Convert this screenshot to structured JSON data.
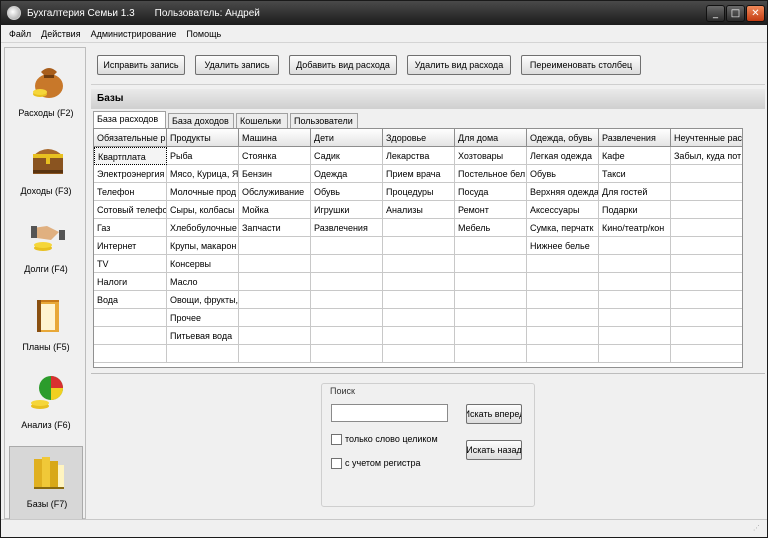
{
  "window": {
    "title": "Бухгалтерия Семьи 1.3",
    "user": "Пользователь: Андрей",
    "min_glyph": "_",
    "max_glyph": "□",
    "close_glyph": "✕"
  },
  "menu": [
    "Файл",
    "Действия",
    "Администрирование",
    "Помощь"
  ],
  "sidebar": [
    {
      "label": "Расходы (F2)",
      "icon": "money-bag-icon"
    },
    {
      "label": "Доходы (F3)",
      "icon": "treasure-chest-icon"
    },
    {
      "label": "Долги (F4)",
      "icon": "handshake-coins-icon"
    },
    {
      "label": "Планы (F5)",
      "icon": "folder-icon"
    },
    {
      "label": "Анализ (F6)",
      "icon": "pie-chart-coins-icon"
    },
    {
      "label": "Базы (F7)",
      "icon": "books-icon"
    }
  ],
  "toolbar": {
    "edit": "Исправить запись",
    "delete": "Удалить запись",
    "add_type": "Добавить вид расхода",
    "delete_type": "Удалить вид расхода",
    "rename_col": "Переименовать столбец"
  },
  "section_title": "Базы",
  "tabs": [
    "База расходов",
    "База доходов",
    "Кошельки",
    "Пользователи"
  ],
  "grid": {
    "columns": [
      "Обязательные р",
      "Продукты",
      "Машина",
      "Дети",
      "Здоровье",
      "Для дома",
      "Одежда, обувь",
      "Развлечения",
      "Неучтенные рас"
    ],
    "rows": [
      [
        "Квартплата",
        "Рыба",
        "Стоянка",
        "Садик",
        "Лекарства",
        "Хозтовары",
        "Легкая одежда",
        "Кафе",
        "Забыл, куда пот"
      ],
      [
        "Электроэнергия",
        "Мясо, Курица, Я",
        "Бензин",
        "Одежда",
        "Прием врача",
        "Постельное бел",
        "Обувь",
        "Такси",
        ""
      ],
      [
        "Телефон",
        "Молочные прод",
        "Обслуживание",
        "Обувь",
        "Процедуры",
        "Посуда",
        "Верхняя одежда",
        "Для гостей",
        ""
      ],
      [
        "Сотовый телефо",
        "Сыры, колбасы",
        "Мойка",
        "Игрушки",
        "Анализы",
        "Ремонт",
        "Аксессуары",
        "Подарки",
        ""
      ],
      [
        "Газ",
        "Хлебобулочные",
        "Запчасти",
        "Развлечения",
        "",
        "Мебель",
        "Сумка, перчатк",
        "Кино/театр/кон",
        ""
      ],
      [
        "Интернет",
        "Крупы, макарон",
        "",
        "",
        "",
        "",
        "Нижнее белье",
        "",
        ""
      ],
      [
        "TV",
        "Консервы",
        "",
        "",
        "",
        "",
        "",
        "",
        ""
      ],
      [
        "Налоги",
        "Масло",
        "",
        "",
        "",
        "",
        "",
        "",
        ""
      ],
      [
        "Вода",
        "Овощи, фрукты,",
        "",
        "",
        "",
        "",
        "",
        "",
        ""
      ],
      [
        "",
        "Прочее",
        "",
        "",
        "",
        "",
        "",
        "",
        ""
      ],
      [
        "",
        "Питьевая вода",
        "",
        "",
        "",
        "",
        "",
        "",
        ""
      ],
      [
        "",
        "",
        "",
        "",
        "",
        "",
        "",
        "",
        ""
      ]
    ]
  },
  "search": {
    "title": "Поиск",
    "value": "",
    "forward": "Искать вперед",
    "backward": "Искать назад",
    "whole_word": "только слово целиком",
    "match_case": "с учетом регистра"
  }
}
